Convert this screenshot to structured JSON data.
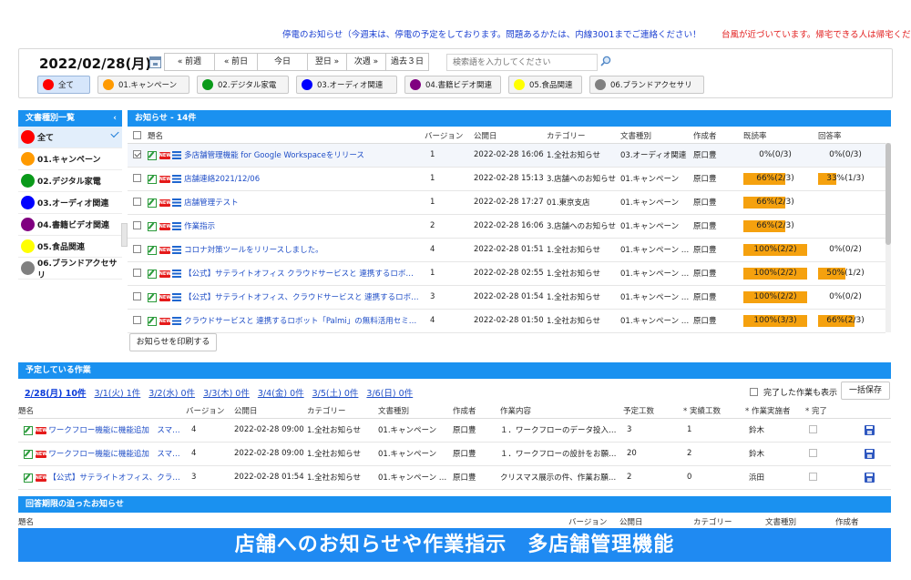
{
  "tickers": {
    "notice_blue": "停電のお知らせ（今週末は、停電の予定をしております。問題あるかたは、内線3001までご連絡ください！",
    "notice_red": "台風が近づいています。帰宅できる人は帰宅くだ"
  },
  "date_bar": {
    "current_date": "2022/02/28(月)",
    "nav": [
      "« 前週",
      "« 前日",
      "今日",
      "翌日 »",
      "次週 »",
      "過去３日"
    ],
    "search_placeholder": "検索語を入力してください"
  },
  "categories": [
    {
      "label": "全て",
      "color": "#ff0000",
      "active": true
    },
    {
      "label": "01.キャンペーン",
      "color": "#ff9a00"
    },
    {
      "label": "02.デジタル家電",
      "color": "#0a9a1a"
    },
    {
      "label": "03.オーディオ関連",
      "color": "#0000ff"
    },
    {
      "label": "04.書籍ビデオ関連",
      "color": "#800080"
    },
    {
      "label": "05.食品関連",
      "color": "#ffff00"
    },
    {
      "label": "06.ブランドアクセサリ",
      "color": "#808080"
    }
  ],
  "sidebar": {
    "title": "文書種別一覧",
    "items": [
      {
        "label": "全て",
        "color": "#ff0000",
        "active": true
      },
      {
        "label": "01.キャンペーン",
        "color": "#ff9a00"
      },
      {
        "label": "02.デジタル家電",
        "color": "#0a9a1a"
      },
      {
        "label": "03.オーディオ関連",
        "color": "#0000ff"
      },
      {
        "label": "04.書籍ビデオ関連",
        "color": "#800080"
      },
      {
        "label": "05.食品関連",
        "color": "#ffff00"
      },
      {
        "label": "06.ブランドアクセサリ",
        "color": "#808080"
      }
    ]
  },
  "notices": {
    "title": "お知らせ - 14件",
    "columns": [
      "題名",
      "バージョン",
      "公開日",
      "カテゴリー",
      "文書種別",
      "作成者",
      "既読率",
      "回答率"
    ],
    "print_label": "お知らせを印刷する",
    "rows": [
      {
        "title": "多店舗管理機能 for Google Workspaceをリリース",
        "version": "1",
        "date": "2022-02-28 16:06",
        "category": "1.全社お知らせ",
        "doctype": "03.オーディオ関連",
        "author": "原口豊",
        "read": "0%(0/3)",
        "read_pct": 0,
        "answer": "0%(0/3)",
        "answer_pct": 0,
        "checked": true
      },
      {
        "title": "店舗連絡2021/12/06",
        "version": "1",
        "date": "2022-02-28 15:13",
        "category": "3.店舗へのお知らせ",
        "doctype": "01.キャンペーン",
        "author": "原口豊",
        "read": "66%(2/3)",
        "read_pct": 66,
        "answer": "33%(1/3)",
        "answer_pct": 33
      },
      {
        "title": "店舗管理テスト",
        "version": "1",
        "date": "2022-02-28 17:27",
        "category": "01.東京支店",
        "doctype": "01.キャンペーン",
        "author": "原口豊",
        "read": "66%(2/3)",
        "read_pct": 66,
        "answer": "",
        "answer_pct": 0
      },
      {
        "title": "作業指示",
        "version": "2",
        "date": "2022-02-28 16:06",
        "category": "3.店舗へのお知らせ",
        "doctype": "01.キャンペーン",
        "author": "原口豊",
        "read": "66%(2/3)",
        "read_pct": 66,
        "answer": "",
        "answer_pct": 0
      },
      {
        "title": "コロナ対策ツールをリリースしました。",
        "version": "4",
        "date": "2022-02-28 01:51",
        "category": "1.全社お知らせ",
        "doctype": "01.キャンペーン …",
        "author": "原口豊",
        "read": "100%(2/2)",
        "read_pct": 100,
        "answer": "0%(0/2)",
        "answer_pct": 0
      },
      {
        "title": "【公式】サテライトオフィス クラウドサービスと 連携するロボ…",
        "version": "1",
        "date": "2022-02-28 02:55",
        "category": "1.全社お知らせ",
        "doctype": "01.キャンペーン …",
        "author": "原口豊",
        "read": "100%(2/2)",
        "read_pct": 100,
        "answer": "50%(1/2)",
        "answer_pct": 50
      },
      {
        "title": "【公式】サテライトオフィス、クラウドサービスと 連携するロボ…",
        "version": "3",
        "date": "2022-02-28 01:54",
        "category": "1.全社お知らせ",
        "doctype": "01.キャンペーン …",
        "author": "原口豊",
        "read": "100%(2/2)",
        "read_pct": 100,
        "answer": "0%(0/2)",
        "answer_pct": 0
      },
      {
        "title": "クラウドサービスと 連携するロボット「Palmi」の無料活用セミ…",
        "version": "4",
        "date": "2022-02-28 01:50",
        "category": "1.全社お知らせ",
        "doctype": "01.キャンペーン …",
        "author": "原口豊",
        "read": "100%(3/3)",
        "read_pct": 100,
        "answer": "66%(2/3)",
        "answer_pct": 66
      }
    ]
  },
  "tasks": {
    "title": "予定している作業",
    "days": [
      "2/28(月) 10件",
      "3/1(火) 1件",
      "3/2(水) 0件",
      "3/3(木) 0件",
      "3/4(金) 0件",
      "3/5(土) 0件",
      "3/6(日) 0件"
    ],
    "show_done_label": "完了した作業も表示",
    "save_all_label": "一括保存",
    "columns": [
      "題名",
      "バージョン",
      "公開日",
      "カテゴリー",
      "文書種別",
      "作成者",
      "作業内容",
      "予定工数",
      "* 実績工数",
      "* 作業実施者",
      "* 完了"
    ],
    "rows": [
      {
        "title": "ワークフロー機能に機能追加　スマ…",
        "version": "4",
        "date": "2022-02-28 09:00",
        "category": "1.全社お知らせ",
        "doctype": "01.キャンペーン",
        "author": "原口豊",
        "content": "１．ワークフローのデータ投入…",
        "planned": "3",
        "actual": "1",
        "assignee": "鈴木"
      },
      {
        "title": "ワークフロー機能に機能追加　スマ…",
        "version": "4",
        "date": "2022-02-28 09:00",
        "category": "1.全社お知らせ",
        "doctype": "01.キャンペーン",
        "author": "原口豊",
        "content": "１．ワークフローの設計をお願…",
        "planned": "20",
        "actual": "2",
        "assignee": "鈴木"
      },
      {
        "title": "【公式】サテライトオフィス、クラ…",
        "version": "3",
        "date": "2022-02-28 01:54",
        "category": "1.全社お知らせ",
        "doctype": "01.キャンペーン …",
        "author": "原口豊",
        "content": "クリスマス展示の件、作業お願…",
        "planned": "2",
        "actual": "0",
        "assignee": "浜田"
      }
    ]
  },
  "deadline": {
    "title": "回答期限の迫ったお知らせ",
    "columns": [
      "題名",
      "バージョン",
      "公開日",
      "カテゴリー",
      "文書種別",
      "作成者"
    ]
  },
  "banner": {
    "text": "店舗へのお知らせや作業指示　多店舗管理機能"
  },
  "colors": {
    "header_blue": "#1a91f0",
    "progress_orange": "#f5a10e",
    "link_blue": "#1f4ec7",
    "banner_blue": "#1f8af2"
  }
}
